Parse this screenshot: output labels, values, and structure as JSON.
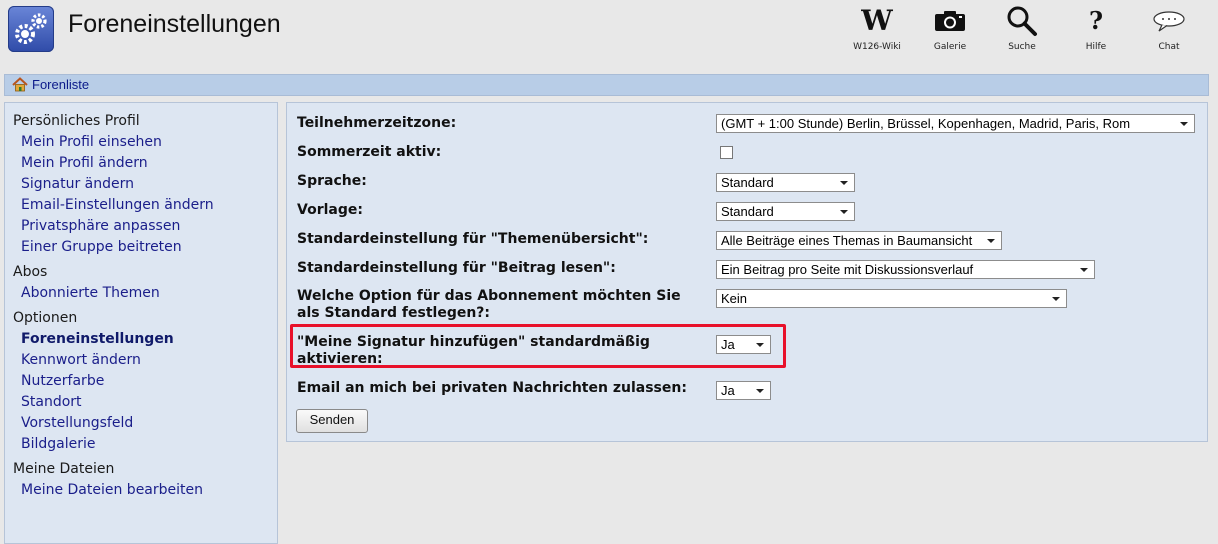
{
  "header": {
    "title": "Foreneinstellungen",
    "app_icon": "gears-icon",
    "nav": [
      {
        "label": "W126-Wiki",
        "icon": "wiki-icon",
        "glyph": "W"
      },
      {
        "label": "Galerie",
        "icon": "camera-icon"
      },
      {
        "label": "Suche",
        "icon": "search-icon"
      },
      {
        "label": "Hilfe",
        "icon": "help-icon",
        "glyph": "?"
      },
      {
        "label": "Chat",
        "icon": "chat-icon"
      }
    ]
  },
  "breadcrumb": {
    "home_icon": "home-icon",
    "label": "Forenliste"
  },
  "sidebar": {
    "sections": [
      {
        "heading": "Persönliches Profil",
        "items": [
          "Mein Profil einsehen",
          "Mein Profil ändern",
          "Signatur ändern",
          "Email-Einstellungen ändern",
          "Privatsphäre anpassen",
          "Einer Gruppe beitreten"
        ]
      },
      {
        "heading": "Abos",
        "items": [
          "Abonnierte Themen"
        ]
      },
      {
        "heading": "Optionen",
        "items": [
          "Foreneinstellungen",
          "Kennwort ändern",
          "Nutzerfarbe",
          "Standort",
          "Vorstellungsfeld",
          "Bildgalerie"
        ]
      },
      {
        "heading": "Meine Dateien",
        "items": [
          "Meine Dateien bearbeiten"
        ]
      }
    ],
    "active_item": "Foreneinstellungen"
  },
  "form": {
    "fields": [
      {
        "label": "Teilnehmerzeitzone:",
        "type": "select",
        "value": "(GMT + 1:00 Stunde) Berlin, Brüssel, Kopenhagen, Madrid, Paris, Rom"
      },
      {
        "label": "Sommerzeit aktiv:",
        "type": "checkbox",
        "checked": false
      },
      {
        "label": "Sprache:",
        "type": "select",
        "value": "Standard"
      },
      {
        "label": "Vorlage:",
        "type": "select",
        "value": "Standard"
      },
      {
        "label": "Standardeinstellung für \"Themenübersicht\":",
        "type": "select",
        "value": "Alle Beiträge eines Themas in Baumansicht"
      },
      {
        "label": "Standardeinstellung für \"Beitrag lesen\":",
        "type": "select",
        "value": "Ein Beitrag pro Seite mit Diskussionsverlauf"
      },
      {
        "label_lines": [
          "Welche Option für das Abonnement möchten Sie",
          "als Standard festlegen?:"
        ],
        "type": "select",
        "value": "Kein"
      },
      {
        "label_lines": [
          "\"Meine Signatur hinzufügen\" standardmäßig",
          "aktivieren:"
        ],
        "type": "select",
        "value": "Ja",
        "highlighted": true
      },
      {
        "label": "Email an mich bei privaten Nachrichten zulassen:",
        "type": "select",
        "value": "Ja"
      }
    ],
    "submit_label": "Senden",
    "highlight_color": "#e8102a"
  }
}
